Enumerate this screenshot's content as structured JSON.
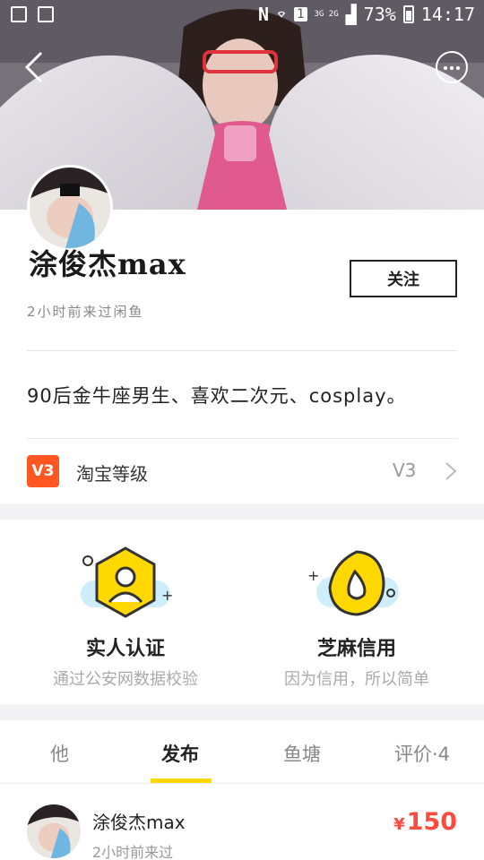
{
  "status_bar": {
    "network_badge": "3G 2G",
    "battery": "73%",
    "time": "14:17"
  },
  "profile": {
    "name": "涂俊杰max",
    "last_seen": "2小时前来过闲鱼",
    "follow_label": "关注",
    "bio": "90后金牛座男生、喜欢二次元、cosplay。",
    "level_badge": "V3",
    "level_label": "淘宝等级",
    "level_value": "V3"
  },
  "verifications": [
    {
      "title": "实人认证",
      "subtitle": "通过公安网数据校验",
      "icon": "id-verify-icon"
    },
    {
      "title": "芝麻信用",
      "subtitle": "因为信用，所以简单",
      "icon": "sesame-credit-icon"
    }
  ],
  "tabs": [
    {
      "label": "他"
    },
    {
      "label": "发布"
    },
    {
      "label": "鱼塘"
    },
    {
      "label": "评价·4"
    }
  ],
  "active_tab": "发布",
  "listing": {
    "seller": "涂俊杰max",
    "time": "2小时前来过",
    "currency": "¥",
    "price": "150"
  },
  "colors": {
    "accent_yellow": "#ffd800",
    "price_red": "#ff4a3d",
    "level_orange": "#ff5722"
  }
}
